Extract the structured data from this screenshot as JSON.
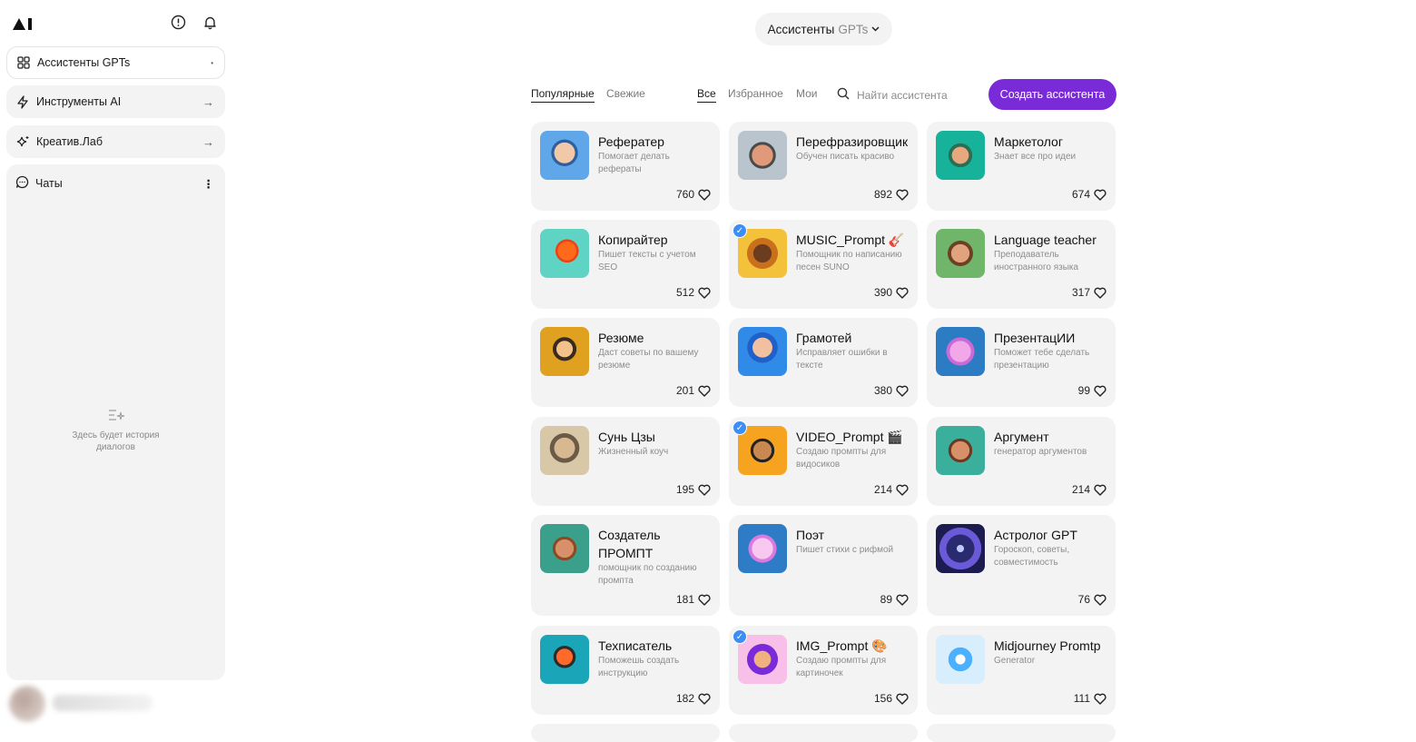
{
  "sidebar": {
    "logo": "AI",
    "nav": [
      {
        "label": "Ассистенты GPTs",
        "trail": "•",
        "icon": "grid-icon"
      },
      {
        "label": "Инструменты AI",
        "trail": "→",
        "icon": "lightning-icon"
      },
      {
        "label": "Креатив.Лаб",
        "trail": "→",
        "icon": "sparkle-icon"
      }
    ],
    "chats": {
      "label": "Чаты",
      "menu": "⋮",
      "empty_line1": "Здесь будет история",
      "empty_line2": "диалогов"
    }
  },
  "header": {
    "dropdown_main": "Ассистенты",
    "dropdown_muted": "GPTs",
    "chevron": "⌄"
  },
  "filters": {
    "sort": [
      {
        "label": "Популярные",
        "selected": true
      },
      {
        "label": "Свежие",
        "selected": false
      }
    ],
    "scope": [
      {
        "label": "Все",
        "selected": true
      },
      {
        "label": "Избранное",
        "selected": false
      },
      {
        "label": "Мои",
        "selected": false
      }
    ],
    "search_placeholder": "Найти ассистента",
    "create_label": "Создать ассистента"
  },
  "accent_color": "#7a2bd8",
  "cards": [
    {
      "title": "Рефератер",
      "desc": [
        "Помогает делать",
        "рефераты"
      ],
      "likes": "760",
      "verified": false
    },
    {
      "title": "Перефразировщик",
      "desc": [
        "Обучен писать красиво"
      ],
      "likes": "892",
      "verified": false
    },
    {
      "title": "Маркетолог",
      "desc": [
        "Знает все про идеи"
      ],
      "likes": "674",
      "verified": false
    },
    {
      "title": "Копирайтер",
      "desc": [
        "Пишет тексты с учетом",
        "SEO"
      ],
      "likes": "512",
      "verified": false
    },
    {
      "title": "MUSIC_Prompt 🎸",
      "desc": [
        "Помощник по написанию",
        "песен SUNO"
      ],
      "likes": "390",
      "verified": true
    },
    {
      "title": "Language teacher",
      "desc": [
        "Преподаватель",
        "иностранного языка"
      ],
      "likes": "317",
      "verified": false
    },
    {
      "title": "Резюме",
      "desc": [
        "Даст советы по вашему",
        "резюме"
      ],
      "likes": "201",
      "verified": false
    },
    {
      "title": "Грамотей",
      "desc": [
        "Исправляет ошибки в",
        "тексте"
      ],
      "likes": "380",
      "verified": false
    },
    {
      "title": "ПрезентацИИ",
      "desc": [
        "Поможет тебе сделать",
        "презентацию"
      ],
      "likes": "99",
      "verified": false
    },
    {
      "title": "Сунь Цзы",
      "desc": [
        "Жизненный коуч"
      ],
      "likes": "195",
      "verified": false
    },
    {
      "title": "VIDEO_Prompt 🎬",
      "desc": [
        "Создаю промпты для",
        "видосиков"
      ],
      "likes": "214",
      "verified": true
    },
    {
      "title": "Аргумент",
      "desc": [
        "генератор аргументов"
      ],
      "likes": "214",
      "verified": false
    },
    {
      "title": "Создатель ПРОМПТ",
      "desc": [
        "помощник по созданию",
        "промпта"
      ],
      "likes": "181",
      "verified": false
    },
    {
      "title": "Поэт",
      "desc": [
        "Пишет стихи с рифмой"
      ],
      "likes": "89",
      "verified": false
    },
    {
      "title": "Астролог GPT",
      "desc": [
        "Гороскоп, советы,",
        "совместимость"
      ],
      "likes": "76",
      "verified": false
    },
    {
      "title": "Техписатель",
      "desc": [
        "Поможешь создать",
        "инструкцию"
      ],
      "likes": "182",
      "verified": false
    },
    {
      "title": "IMG_Prompt 🎨",
      "desc": [
        "Создаю промпты для",
        "картиночек"
      ],
      "likes": "156",
      "verified": true
    },
    {
      "title": "Midjourney Promtp",
      "desc": [
        "Generator"
      ],
      "likes": "111",
      "verified": false
    }
  ]
}
